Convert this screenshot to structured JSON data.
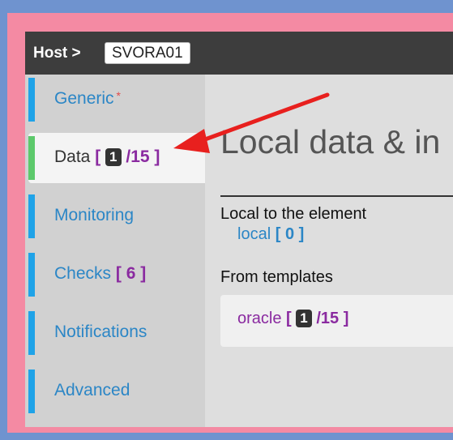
{
  "header": {
    "host_label": "Host >",
    "host_name": "SVORA01"
  },
  "sidebar": {
    "items": [
      {
        "label": "Generic",
        "required_mark": "*"
      },
      {
        "label": "Data",
        "badge_open": "[",
        "badge_count": "1",
        "badge_total": "/15",
        "badge_close": "]"
      },
      {
        "label": "Monitoring"
      },
      {
        "label": "Checks",
        "badge_open": "[",
        "badge_count": "6",
        "badge_close": "]"
      },
      {
        "label": "Notifications"
      },
      {
        "label": "Advanced"
      }
    ]
  },
  "main": {
    "title": "Local data & in",
    "local_section": {
      "heading": "Local to the element",
      "item_label": "local",
      "open": "[",
      "count": "0",
      "close": "]"
    },
    "templates_section": {
      "heading": "From templates",
      "item_label": "oracle",
      "open": "[",
      "count": "1",
      "total": "/15",
      "close": "]"
    }
  },
  "colors": {
    "outer_background": "#6f93cf",
    "frame_border": "#f48aa3",
    "header": "#3d3d3d",
    "link_blue": "#2b86c6",
    "accent_purple": "#8a2aa0",
    "active_green": "#5cc96b",
    "annotation_arrow": "#e8201e"
  }
}
